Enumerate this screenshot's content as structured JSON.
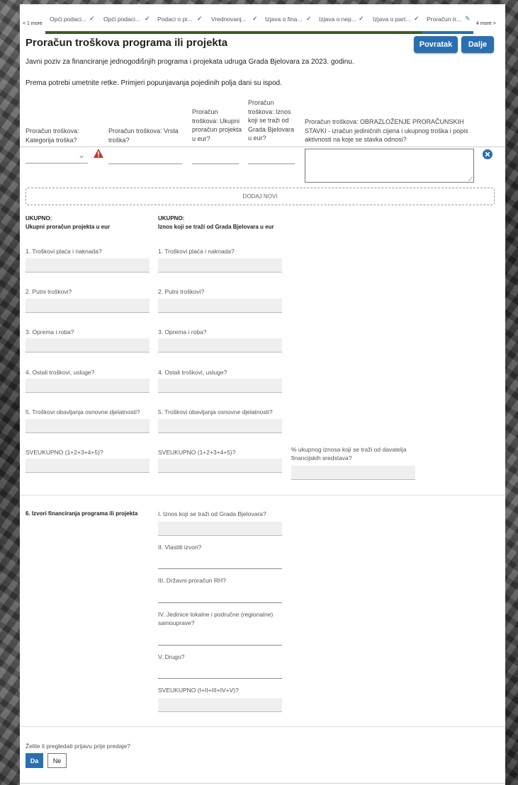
{
  "stepper": {
    "prev_more": "< 1 more",
    "next_more": "4 more >",
    "steps": [
      {
        "label": "Opći podaci...",
        "icon": "check-icon"
      },
      {
        "label": "Opći podaci...",
        "icon": "check-icon"
      },
      {
        "label": "Podaci o pr...",
        "icon": "check-icon"
      },
      {
        "label": "Vrednovanj...",
        "icon": "check-icon"
      },
      {
        "label": "Izjava o fina...",
        "icon": "check-icon"
      },
      {
        "label": "Izjava o nep...",
        "icon": "check-icon"
      },
      {
        "label": "Izjava o part...",
        "icon": "check-icon"
      },
      {
        "label": "Proračun tr...",
        "icon": "pencil-icon"
      }
    ]
  },
  "header": {
    "title": "Proračun troškova programa ili projekta",
    "back_label": "Povratak",
    "next_label": "Dalje"
  },
  "intro": "Javni poziv za financiranje jednogodišnjih programa i projekata udruga Grada Bjelovara za 2023. godinu.",
  "instructions": "Prema potrebi umetnite retke. Primjeri popunjavanja pojedinih polja dani su ispod.",
  "table": {
    "columns": [
      "Proračun troškova: Kategorija troška?",
      "Proračun troškova: Vrsta troška?",
      "Proračun troškova: Ukupni proračun projekta u eur?",
      "Proračun troškova: Iznos koji se traži od Grada Bjelovara u eur?",
      "Proračun troškova: OBRAZLOŽENJE PRORAČUNSKIH STAVKI - izračun jediničnih cijena i ukupnog troška i popis aktivnosti na koje se stavka odnosi?"
    ],
    "add_row_label": "DODAJ NOVI"
  },
  "totals_left": {
    "heading_1": "UKUPNO:",
    "heading_2": "Ukupni proračun projekta u eur",
    "fields": [
      "1. Troškovi plaća i naknada?",
      "2. Putni troškovi?",
      "3. Oprema i roba?",
      "4. Ostali troškovi, usluge?",
      "5. Troškovi obavljanja osnovne djelatnosti?",
      "SVEUKUPNO (1+2+3+4+5)?"
    ]
  },
  "totals_right": {
    "heading_1": "UKUPNO:",
    "heading_2": "Iznos koji se traži od Grada Bjelovara u eur",
    "fields": [
      "1. Troškovi plaća i naknada?",
      "2. Putni troškovi?",
      "3. Oprema i roba?",
      "4. Ostali troškovi, usluge?",
      "5. Troškovi obavljanja osnovne djelatnosti?",
      "SVEUKUPNO (1+2+3+4+5)?"
    ]
  },
  "percent_label": "% ukupnog iznosa koji se traži od davatelja financijskih sredstava?",
  "sources": {
    "heading": "6. Izvori financiranja programa ili projekta",
    "fields": [
      "I. Iznos koji se traži od Grada Bjelovara?",
      "II. Vlastiti izvori?",
      "III. Državni proračun RH?",
      "IV. Jedinice lokalne i područne (regionalne) samouprave?",
      "V. Drugo?",
      "SVEUKUPNO (I+II+III+IV+V)?"
    ]
  },
  "review": {
    "question": "Želite li pregledati prijavu prije predaje?",
    "yes": "Da",
    "no": "Ne"
  },
  "colors": {
    "accent": "#2a6fb0",
    "step_done": "#3f5a2a",
    "error": "#c0392b"
  }
}
